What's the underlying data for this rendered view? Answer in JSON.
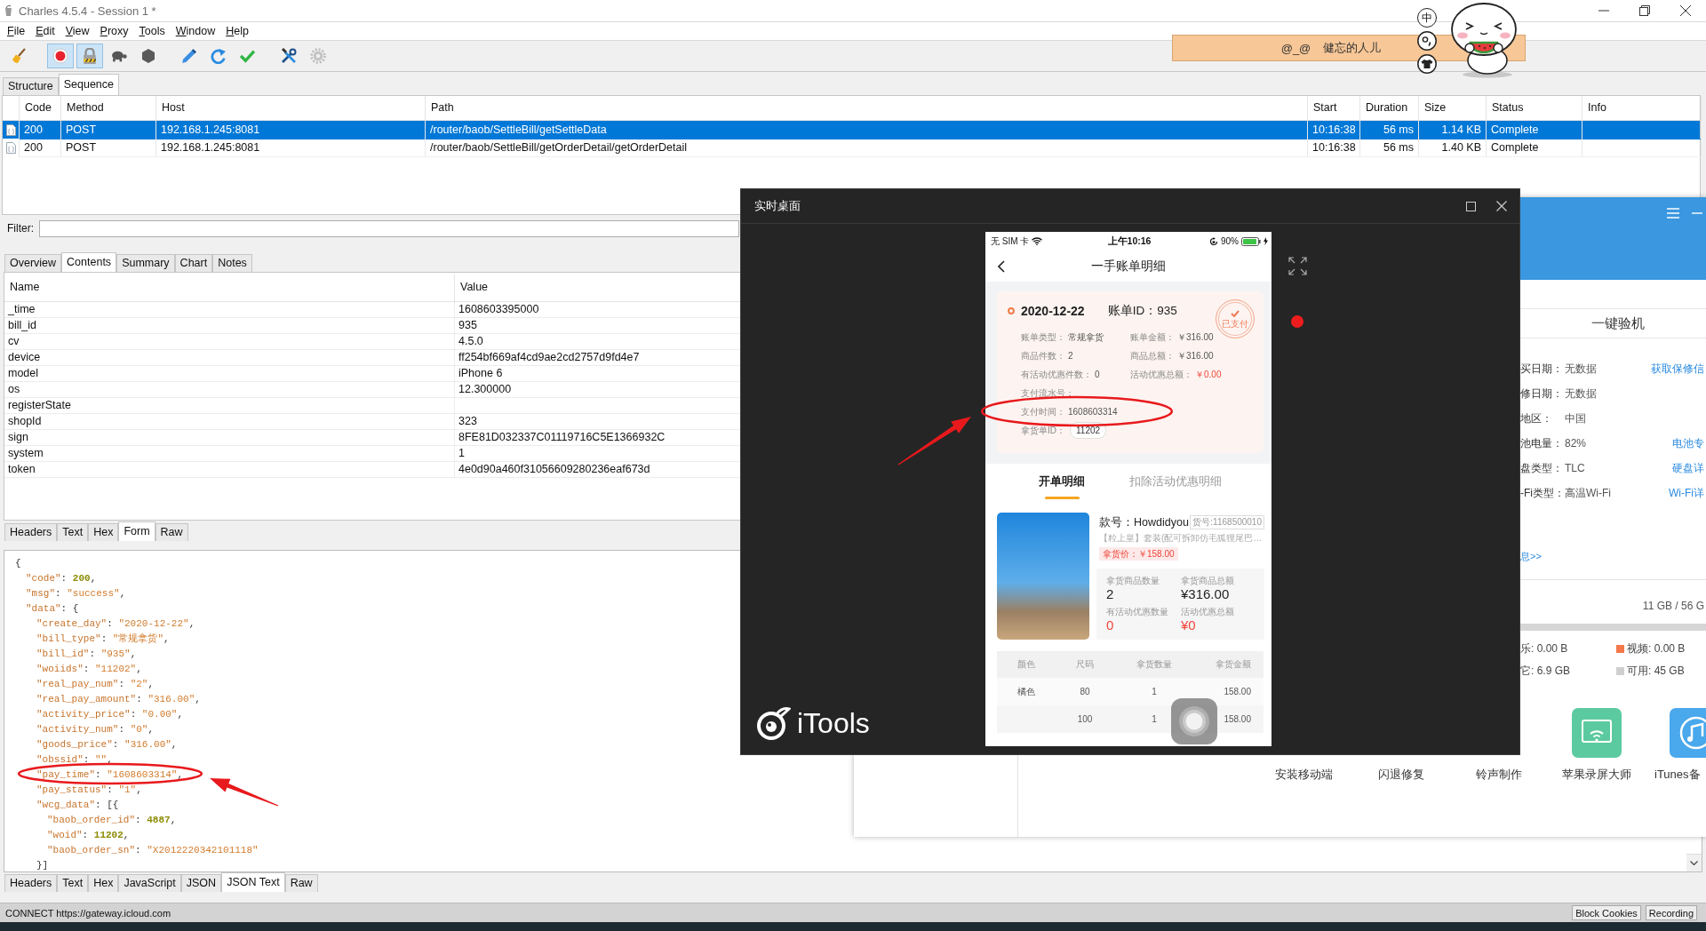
{
  "charles": {
    "title": "Charles 4.5.4 - Session 1 *",
    "menu": [
      "File",
      "Edit",
      "View",
      "Proxy",
      "Tools",
      "Window",
      "Help"
    ],
    "toolbar": [
      {
        "kind": "broom",
        "pressed": false
      },
      {
        "kind": "record",
        "pressed": true
      },
      {
        "kind": "lock",
        "pressed": true
      },
      {
        "kind": "turtle",
        "pressed": false
      },
      {
        "kind": "hexagon",
        "pressed": false
      },
      {
        "kind": "pen",
        "pressed": false
      },
      {
        "kind": "refresh",
        "pressed": false
      },
      {
        "kind": "check",
        "pressed": false
      },
      {
        "kind": "tools",
        "pressed": false
      },
      {
        "kind": "gear",
        "pressed": false
      }
    ],
    "view_tabs": [
      {
        "label": "Structure",
        "selected": false
      },
      {
        "label": "Sequence",
        "selected": true
      }
    ],
    "requests": {
      "columns": [
        "Code",
        "Method",
        "Host",
        "Path",
        "Start",
        "Duration",
        "Size",
        "Status",
        "Info"
      ],
      "rows": [
        {
          "selected": true,
          "cells": [
            "200",
            "POST",
            "192.168.1.245:8081",
            "/router/baob/SettleBill/getSettleData",
            "10:16:38",
            "56 ms",
            "1.14 KB",
            "Complete"
          ]
        },
        {
          "selected": false,
          "cells": [
            "200",
            "POST",
            "192.168.1.245:8081",
            "/router/baob/SettleBill/getOrderDetail/getOrderDetail",
            "10:16:38",
            "56 ms",
            "1.40 KB",
            "Complete"
          ]
        }
      ]
    },
    "filter": {
      "label": "Filter:"
    },
    "detail_tabs": [
      {
        "label": "Overview",
        "selected": false
      },
      {
        "label": "Contents",
        "selected": true
      },
      {
        "label": "Summary",
        "selected": false
      },
      {
        "label": "Chart",
        "selected": false
      },
      {
        "label": "Notes",
        "selected": false
      }
    ],
    "params": {
      "columns": [
        "Name",
        "Value"
      ],
      "rows": [
        {
          "name": "_time",
          "value": "1608603395000"
        },
        {
          "name": "bill_id",
          "value": "935"
        },
        {
          "name": "cv",
          "value": "4.5.0"
        },
        {
          "name": "device",
          "value": "ff254bf669af4cd9ae2cd2757d9fd4e7"
        },
        {
          "name": "model",
          "value": "iPhone 6"
        },
        {
          "name": "os",
          "value": "12.300000"
        },
        {
          "name": "registerState"
        },
        {
          "name": "shopId",
          "value": "323"
        },
        {
          "name": "sign",
          "value": "8FE81D032337C01119716C5E1366932C"
        },
        {
          "name": "system",
          "value": "1"
        },
        {
          "name": "token",
          "value": "4e0d90a460f31056609280236eaf673d"
        }
      ]
    },
    "request_tabs": [
      {
        "label": "Headers",
        "selected": false
      },
      {
        "label": "Text",
        "selected": false
      },
      {
        "label": "Hex",
        "selected": false
      },
      {
        "label": "Form",
        "selected": true
      },
      {
        "label": "Raw",
        "selected": false
      }
    ],
    "response_lines": [
      {
        "tokens": [
          {
            "kind": "punct",
            "text": "{"
          }
        ],
        "children": [
          {
            "tokens": [
              {
                "kind": "key",
                "text": "\"code\""
              },
              {
                "kind": "punct",
                "text": ": "
              },
              {
                "kind": "number",
                "text": "200"
              },
              {
                "kind": "punct",
                "text": ","
              }
            ]
          },
          {
            "tokens": [
              {
                "kind": "key",
                "text": "\"msg\""
              },
              {
                "kind": "punct",
                "text": ": "
              },
              {
                "kind": "string",
                "text": "\"success\""
              },
              {
                "kind": "punct",
                "text": ","
              }
            ]
          },
          {
            "tokens": [
              {
                "kind": "key",
                "text": "\"data\""
              },
              {
                "kind": "punct",
                "text": ": {"
              }
            ],
            "children": [
              {
                "tokens": [
                  {
                    "kind": "key",
                    "text": "\"create_day\""
                  },
                  {
                    "kind": "punct",
                    "text": ": "
                  },
                  {
                    "kind": "string",
                    "text": "\"2020-12-22\""
                  },
                  {
                    "kind": "punct",
                    "text": ","
                  }
                ]
              },
              {
                "tokens": [
                  {
                    "kind": "key",
                    "text": "\"bill_type\""
                  },
                  {
                    "kind": "punct",
                    "text": ": "
                  },
                  {
                    "kind": "string",
                    "text": "\"常规拿货\""
                  },
                  {
                    "kind": "punct",
                    "text": ","
                  }
                ]
              },
              {
                "tokens": [
                  {
                    "kind": "key",
                    "text": "\"bill_id\""
                  },
                  {
                    "kind": "punct",
                    "text": ": "
                  },
                  {
                    "kind": "string",
                    "text": "\"935\""
                  },
                  {
                    "kind": "punct",
                    "text": ","
                  }
                ]
              },
              {
                "tokens": [
                  {
                    "kind": "key",
                    "text": "\"woiids\""
                  },
                  {
                    "kind": "punct",
                    "text": ": "
                  },
                  {
                    "kind": "string",
                    "text": "\"11202\""
                  },
                  {
                    "kind": "punct",
                    "text": ","
                  }
                ]
              },
              {
                "tokens": [
                  {
                    "kind": "key",
                    "text": "\"real_pay_num\""
                  },
                  {
                    "kind": "punct",
                    "text": ": "
                  },
                  {
                    "kind": "string",
                    "text": "\"2\""
                  },
                  {
                    "kind": "punct",
                    "text": ","
                  }
                ]
              },
              {
                "tokens": [
                  {
                    "kind": "key",
                    "text": "\"real_pay_amount\""
                  },
                  {
                    "kind": "punct",
                    "text": ": "
                  },
                  {
                    "kind": "string",
                    "text": "\"316.00\""
                  },
                  {
                    "kind": "punct",
                    "text": ","
                  }
                ]
              },
              {
                "tokens": [
                  {
                    "kind": "key",
                    "text": "\"activity_price\""
                  },
                  {
                    "kind": "punct",
                    "text": ": "
                  },
                  {
                    "kind": "string",
                    "text": "\"0.00\""
                  },
                  {
                    "kind": "punct",
                    "text": ","
                  }
                ]
              },
              {
                "tokens": [
                  {
                    "kind": "key",
                    "text": "\"activity_num\""
                  },
                  {
                    "kind": "punct",
                    "text": ": "
                  },
                  {
                    "kind": "string",
                    "text": "\"0\""
                  },
                  {
                    "kind": "punct",
                    "text": ","
                  }
                ]
              },
              {
                "tokens": [
                  {
                    "kind": "key",
                    "text": "\"goods_price\""
                  },
                  {
                    "kind": "punct",
                    "text": ": "
                  },
                  {
                    "kind": "string",
                    "text": "\"316.00\""
                  },
                  {
                    "kind": "punct",
                    "text": ","
                  }
                ]
              },
              {
                "tokens": [
                  {
                    "kind": "key",
                    "text": "\"obssid\""
                  },
                  {
                    "kind": "punct",
                    "text": ": "
                  },
                  {
                    "kind": "string",
                    "text": "\"\""
                  },
                  {
                    "kind": "punct",
                    "text": ","
                  }
                ]
              },
              {
                "tokens": [
                  {
                    "kind": "key",
                    "text": "\"pay_time\""
                  },
                  {
                    "kind": "punct",
                    "text": ": "
                  },
                  {
                    "kind": "string",
                    "text": "\"1608603314\""
                  },
                  {
                    "kind": "punct",
                    "text": ","
                  }
                ]
              },
              {
                "tokens": [
                  {
                    "kind": "key",
                    "text": "\"pay_status\""
                  },
                  {
                    "kind": "punct",
                    "text": ": "
                  },
                  {
                    "kind": "string",
                    "text": "\"1\""
                  },
                  {
                    "kind": "punct",
                    "text": ","
                  }
                ]
              },
              {
                "tokens": [
                  {
                    "kind": "key",
                    "text": "\"wcg_data\""
                  },
                  {
                    "kind": "punct",
                    "text": ": [{"
                  }
                ],
                "children": [
                  {
                    "tokens": [
                      {
                        "kind": "key",
                        "text": "\"baob_order_id\""
                      },
                      {
                        "kind": "punct",
                        "text": ": "
                      },
                      {
                        "kind": "number",
                        "text": "4887"
                      },
                      {
                        "kind": "punct",
                        "text": ","
                      }
                    ]
                  },
                  {
                    "tokens": [
                      {
                        "kind": "key",
                        "text": "\"woid\""
                      },
                      {
                        "kind": "punct",
                        "text": ": "
                      },
                      {
                        "kind": "number",
                        "text": "11202"
                      },
                      {
                        "kind": "punct",
                        "text": ","
                      }
                    ]
                  },
                  {
                    "tokens": [
                      {
                        "kind": "key",
                        "text": "\"baob_order_sn\""
                      },
                      {
                        "kind": "punct",
                        "text": ": "
                      },
                      {
                        "kind": "string",
                        "text": "\"X2012220342101118\""
                      }
                    ]
                  }
                ]
              },
              {
                "tokens": [
                  {
                    "kind": "punct",
                    "text": "}]"
                  }
                ]
              }
            ]
          }
        ]
      }
    ],
    "response_annotations": [
      {
        "kind": "ellipse"
      },
      {
        "kind": "arrow"
      }
    ],
    "response_tabs": [
      {
        "label": "Headers",
        "selected": false
      },
      {
        "label": "Text",
        "selected": false
      },
      {
        "label": "Hex",
        "selected": false
      },
      {
        "label": "JavaScript",
        "selected": false
      },
      {
        "label": "JSON",
        "selected": false
      },
      {
        "label": "JSON Text",
        "selected": true
      },
      {
        "label": "Raw",
        "selected": false
      }
    ],
    "status_bar": {
      "text": "CONNECT https://gateway.icloud.com",
      "buttons": [
        "Block Cookies",
        "Recording"
      ]
    }
  },
  "sticky_note": {
    "emoticon": "@_@",
    "text": "健忘的人儿"
  },
  "ime_toolbar": [
    {
      "kind": "text",
      "label": "中"
    },
    {
      "kind": "punctuation"
    },
    {
      "kind": "skin"
    }
  ],
  "mirror_window": {
    "title": "实时桌面",
    "logo": "iTools",
    "phone": {
      "status_bar": {
        "carrier": "无 SIM 卡",
        "time": "上午10:16",
        "battery": "90%"
      },
      "title": "一手账单明细",
      "bill": {
        "date": "2020-12-22",
        "bill_id": "账单ID：935",
        "stamp": "已支付",
        "fields": [
          {
            "label": "账单类型：",
            "value": "常规拿货",
            "emphasis": false
          },
          {
            "label": "账单金额：",
            "value": "￥316.00",
            "emphasis": false
          },
          {
            "label": "商品件数：",
            "value": "2",
            "emphasis": false
          },
          {
            "label": "商品总额：",
            "value": "￥316.00",
            "emphasis": false
          },
          {
            "label": "有活动优惠件数：",
            "value": "0",
            "emphasis": false
          },
          {
            "label": "活动优惠总额：",
            "value": "￥0.00",
            "emphasis": true
          }
        ],
        "details": [
          {
            "kind": "text",
            "label": "支付流水号："
          },
          {
            "kind": "text",
            "label": "支付时间：",
            "value": "1608603314"
          },
          {
            "kind": "pill",
            "label": "拿货单ID：",
            "value": "11202"
          }
        ]
      },
      "tabs": [
        {
          "label": "开单明细",
          "selected": true
        },
        {
          "label": "扣除活动优惠明细",
          "selected": false
        }
      ],
      "product": {
        "style_no": "款号：Howdidyou",
        "sku": "货号:1168500010",
        "name": "【粒上皇】套装(配可拆卸仿毛狐狸尾巴…",
        "price": "拿货价：￥158.00",
        "stats": [
          {
            "label": "拿货商品数量",
            "value": "2",
            "emphasis": false
          },
          {
            "label": "拿货商品总额",
            "value": "¥316.00",
            "emphasis": false
          },
          {
            "label": "有活动优惠数量",
            "value": "0",
            "emphasis": true
          },
          {
            "label": "活动优惠总额",
            "value": "¥0",
            "emphasis": true
          }
        ]
      },
      "sizes": {
        "columns": [
          "颜色",
          "尺码",
          "拿货数量",
          "拿货金额"
        ],
        "rows": [
          {
            "color_name": "橘色",
            "size": "80",
            "quantity": "1",
            "amount": "158.00"
          },
          {
            "size": "100",
            "quantity": "1",
            "amount": "158.00"
          }
        ]
      },
      "annotations": [
        {
          "kind": "ellipse"
        },
        {
          "kind": "arrow"
        }
      ]
    }
  },
  "itools_window": {
    "section_title": "一键验机",
    "info_rows": [
      {
        "label": "买日期：",
        "value": "无数据",
        "link": "获取保修信"
      },
      {
        "label": "修日期：",
        "value": "无数据"
      },
      {
        "label": "地区：",
        "value": "中国"
      },
      {
        "label": "池电量：",
        "value": "82%",
        "link": "电池专"
      },
      {
        "label": "盘类型：",
        "value": "TLC",
        "link": "硬盘详"
      },
      {
        "label": "-Fi类型：",
        "value": "高温Wi-Fi",
        "link": "Wi-Fi详"
      }
    ],
    "more_link": "息>>",
    "storage": "11 GB / 56 G",
    "legend": [
      {
        "label": "乐: 0.00 B"
      },
      {
        "label": "视频: 0.00 B",
        "color": "#f4784a"
      },
      {
        "label": "它: 6.9 GB"
      },
      {
        "label": "可用: 45 GB",
        "color": "#cfcfcf"
      }
    ],
    "tools": [
      {
        "label": "安装移动端"
      },
      {
        "label": "闪退修复"
      },
      {
        "label": "铃声制作"
      },
      {
        "label": "苹果录屏大师",
        "kind": "screen"
      },
      {
        "label": "iTunes备",
        "kind": "music"
      }
    ]
  }
}
